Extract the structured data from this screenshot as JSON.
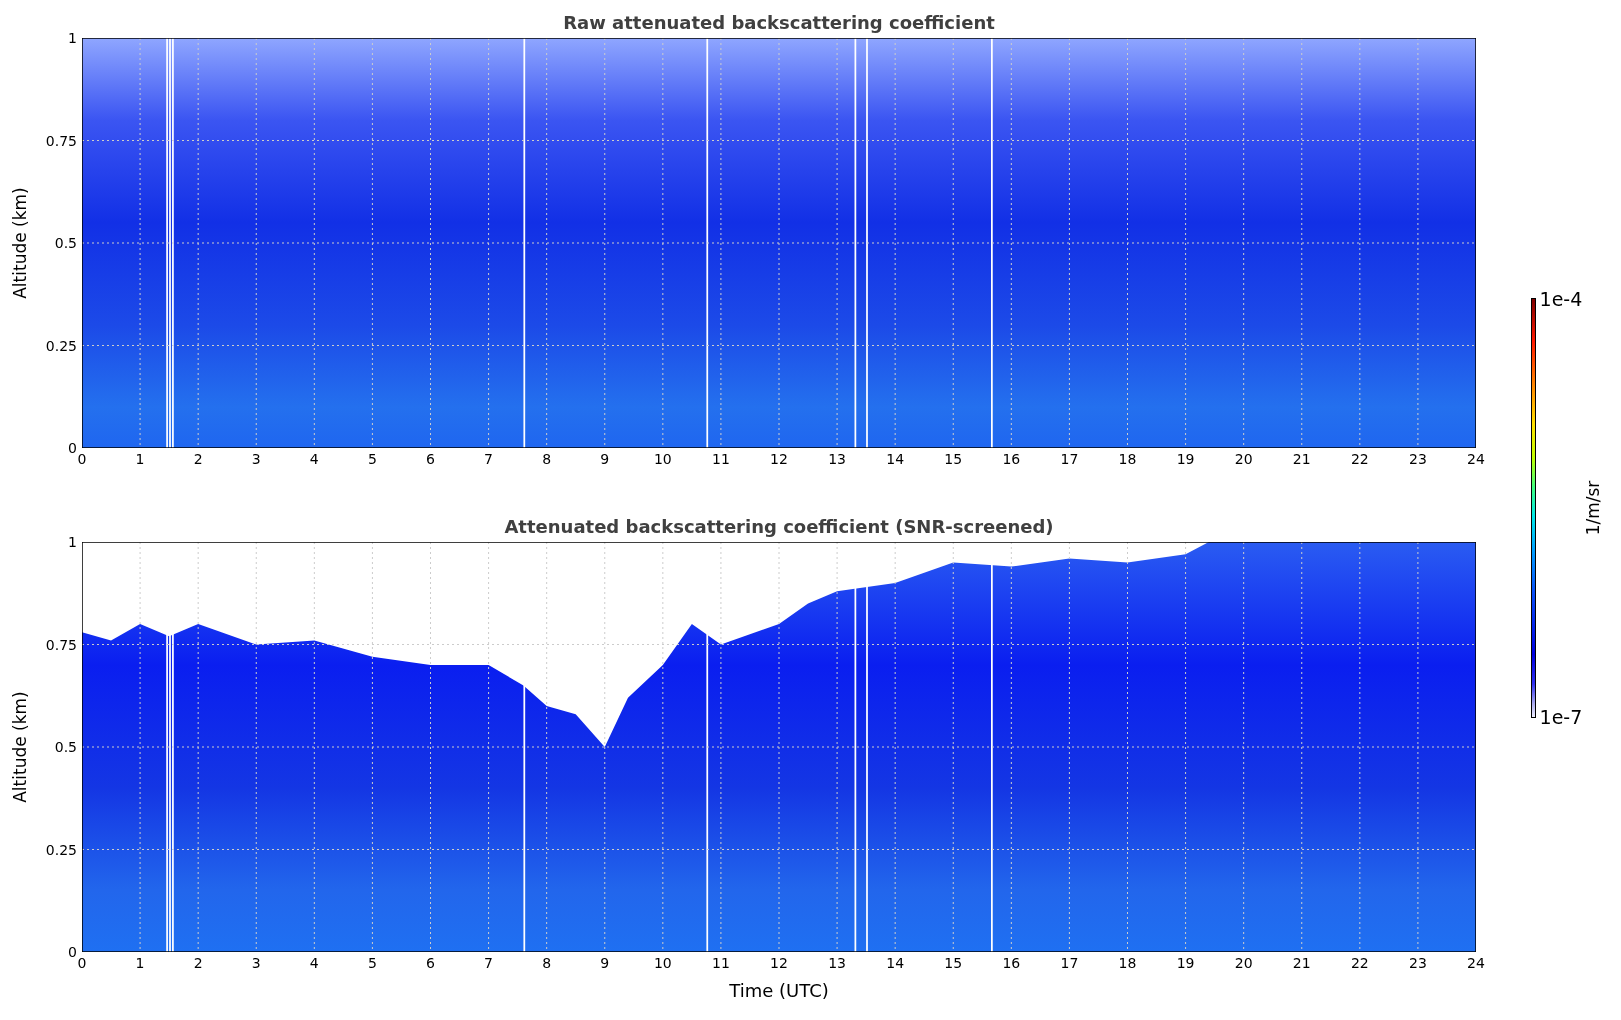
{
  "panels": [
    {
      "title": "Raw attenuated backscattering coefficient",
      "kind": "raw",
      "ylabel": "Altitude (km)",
      "yticks": [
        "1",
        "0.75",
        "0.5",
        "0.25",
        "0"
      ],
      "xticks": [
        "0",
        "1",
        "2",
        "3",
        "4",
        "5",
        "6",
        "7",
        "8",
        "9",
        "10",
        "11",
        "12",
        "13",
        "14",
        "15",
        "16",
        "17",
        "18",
        "19",
        "20",
        "21",
        "22",
        "23",
        "24"
      ]
    },
    {
      "title": "Attenuated backscattering coefficient (SNR-screened)",
      "kind": "screened",
      "ylabel": "Altitude (km)",
      "yticks": [
        "1",
        "0.75",
        "0.5",
        "0.25",
        "0"
      ],
      "xticks": [
        "0",
        "1",
        "2",
        "3",
        "4",
        "5",
        "6",
        "7",
        "8",
        "9",
        "10",
        "11",
        "12",
        "13",
        "14",
        "15",
        "16",
        "17",
        "18",
        "19",
        "20",
        "21",
        "22",
        "23",
        "24"
      ],
      "xlabel": "Time (UTC)"
    }
  ],
  "colorbar": {
    "max_label": "1e-4",
    "min_label": "1e-7",
    "label": "1/m/sr"
  }
}
